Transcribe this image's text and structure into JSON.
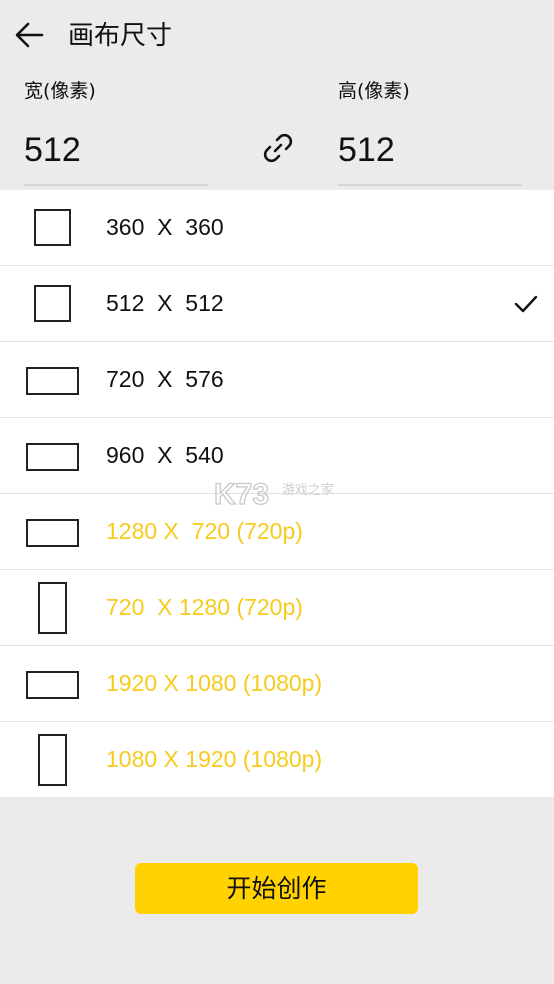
{
  "header": {
    "title": "画布尺寸"
  },
  "dimensions": {
    "width_label": "宽(像素)",
    "width_value": "512",
    "height_label": "高(像素)",
    "height_value": "512"
  },
  "sizes": [
    {
      "label": "360  X  360",
      "shape": "square",
      "premium": false,
      "selected": false
    },
    {
      "label": "512  X  512",
      "shape": "square",
      "premium": false,
      "selected": true
    },
    {
      "label": "720  X  576",
      "shape": "landscape",
      "premium": false,
      "selected": false
    },
    {
      "label": "960  X  540",
      "shape": "landscape",
      "premium": false,
      "selected": false
    },
    {
      "label": "1280 X  720 (720p)",
      "shape": "landscape",
      "premium": true,
      "selected": false
    },
    {
      "label": "720  X 1280 (720p)",
      "shape": "portrait",
      "premium": true,
      "selected": false
    },
    {
      "label": "1920 X 1080 (1080p)",
      "shape": "landscape",
      "premium": true,
      "selected": false
    },
    {
      "label": "1080 X 1920 (1080p)",
      "shape": "portrait",
      "premium": true,
      "selected": false
    }
  ],
  "watermark": {
    "logo_text": "K73",
    "sub_text": "游戏之家"
  },
  "actions": {
    "start_label": "开始创作"
  },
  "colors": {
    "background": "#ebebeb",
    "accent": "#ffd200",
    "premium_text": "#f7cb1e",
    "list_background": "#ffffff"
  }
}
